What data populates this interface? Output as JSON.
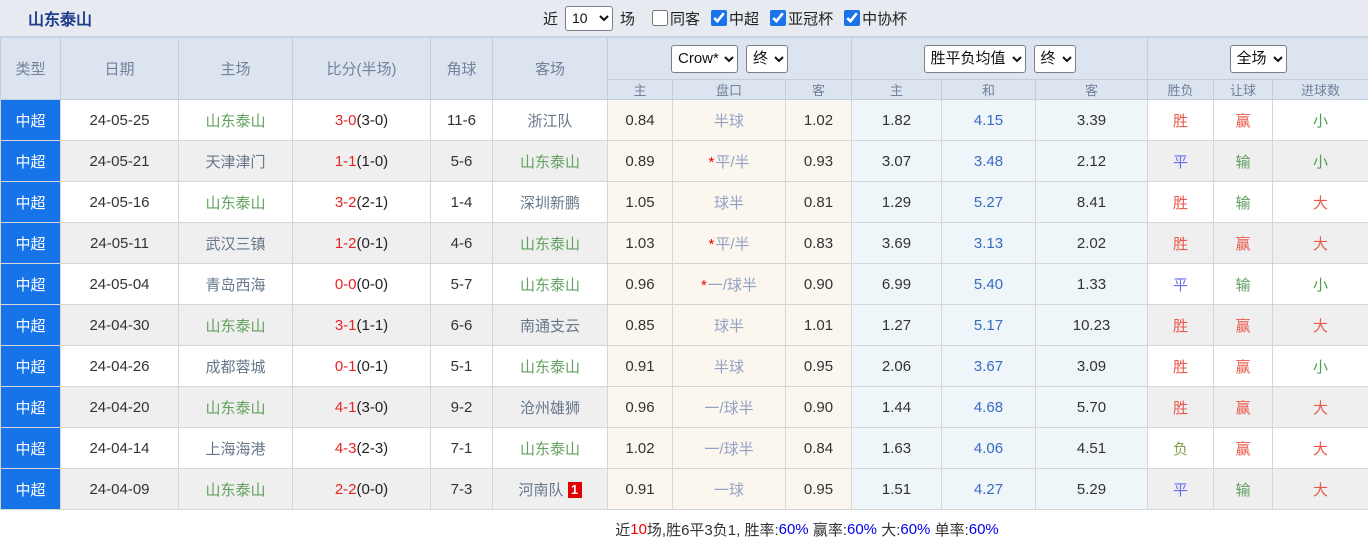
{
  "title": "山东泰山",
  "topbar": {
    "near_label": "近",
    "matches_count": "10",
    "matches_label": "场",
    "filters": [
      {
        "label": "同客",
        "checked": false
      },
      {
        "label": "中超",
        "checked": true
      },
      {
        "label": "亚冠杯",
        "checked": true
      },
      {
        "label": "中协杯",
        "checked": true
      }
    ]
  },
  "table": {
    "main_headers": [
      "类型",
      "日期",
      "主场",
      "比分(半场)",
      "角球",
      "客场"
    ],
    "asian_group": {
      "select_company": "Crow*",
      "select_time": "终",
      "sub_headers": [
        "主",
        "盘口",
        "客"
      ]
    },
    "euro_group": {
      "select_company": "胜平负均值",
      "select_time": "终",
      "sub_headers": [
        "主",
        "和",
        "客"
      ]
    },
    "result_group": {
      "select_scope": "全场",
      "sub_headers": [
        "胜负",
        "让球",
        "进球数"
      ]
    },
    "star_symbol": "*",
    "rows": [
      {
        "type": "中超",
        "date": "24-05-25",
        "home": "山东泰山",
        "score": "3-0",
        "half": "(3-0)",
        "corners": "11-6",
        "away": "浙江队",
        "away_badge": "",
        "ah_home": "0.84",
        "ah_star": false,
        "ah_line": "半球",
        "ah_away": "1.02",
        "eu_home": "1.82",
        "eu_draw": "4.15",
        "eu_away": "3.39",
        "win": "胜",
        "handicap": "赢",
        "goals": "小"
      },
      {
        "type": "中超",
        "date": "24-05-21",
        "home": "天津津门",
        "score": "1-1",
        "half": "(1-0)",
        "corners": "5-6",
        "away": "山东泰山",
        "away_badge": "",
        "ah_home": "0.89",
        "ah_star": true,
        "ah_line": "平/半",
        "ah_away": "0.93",
        "eu_home": "3.07",
        "eu_draw": "3.48",
        "eu_away": "2.12",
        "win": "平",
        "handicap": "输",
        "goals": "小"
      },
      {
        "type": "中超",
        "date": "24-05-16",
        "home": "山东泰山",
        "score": "3-2",
        "half": "(2-1)",
        "corners": "1-4",
        "away": "深圳新鹏",
        "away_badge": "",
        "ah_home": "1.05",
        "ah_star": false,
        "ah_line": "球半",
        "ah_away": "0.81",
        "eu_home": "1.29",
        "eu_draw": "5.27",
        "eu_away": "8.41",
        "win": "胜",
        "handicap": "输",
        "goals": "大"
      },
      {
        "type": "中超",
        "date": "24-05-11",
        "home": "武汉三镇",
        "score": "1-2",
        "half": "(0-1)",
        "corners": "4-6",
        "away": "山东泰山",
        "away_badge": "",
        "ah_home": "1.03",
        "ah_star": true,
        "ah_line": "平/半",
        "ah_away": "0.83",
        "eu_home": "3.69",
        "eu_draw": "3.13",
        "eu_away": "2.02",
        "win": "胜",
        "handicap": "赢",
        "goals": "大"
      },
      {
        "type": "中超",
        "date": "24-05-04",
        "home": "青岛西海",
        "score": "0-0",
        "half": "(0-0)",
        "corners": "5-7",
        "away": "山东泰山",
        "away_badge": "",
        "ah_home": "0.96",
        "ah_star": true,
        "ah_line": "一/球半",
        "ah_away": "0.90",
        "eu_home": "6.99",
        "eu_draw": "5.40",
        "eu_away": "1.33",
        "win": "平",
        "handicap": "输",
        "goals": "小"
      },
      {
        "type": "中超",
        "date": "24-04-30",
        "home": "山东泰山",
        "score": "3-1",
        "half": "(1-1)",
        "corners": "6-6",
        "away": "南通支云",
        "away_badge": "",
        "ah_home": "0.85",
        "ah_star": false,
        "ah_line": "球半",
        "ah_away": "1.01",
        "eu_home": "1.27",
        "eu_draw": "5.17",
        "eu_away": "10.23",
        "win": "胜",
        "handicap": "赢",
        "goals": "大"
      },
      {
        "type": "中超",
        "date": "24-04-26",
        "home": "成都蓉城",
        "score": "0-1",
        "half": "(0-1)",
        "corners": "5-1",
        "away": "山东泰山",
        "away_badge": "",
        "ah_home": "0.91",
        "ah_star": false,
        "ah_line": "半球",
        "ah_away": "0.95",
        "eu_home": "2.06",
        "eu_draw": "3.67",
        "eu_away": "3.09",
        "win": "胜",
        "handicap": "赢",
        "goals": "小"
      },
      {
        "type": "中超",
        "date": "24-04-20",
        "home": "山东泰山",
        "score": "4-1",
        "half": "(3-0)",
        "corners": "9-2",
        "away": "沧州雄狮",
        "away_badge": "",
        "ah_home": "0.96",
        "ah_star": false,
        "ah_line": "一/球半",
        "ah_away": "0.90",
        "eu_home": "1.44",
        "eu_draw": "4.68",
        "eu_away": "5.70",
        "win": "胜",
        "handicap": "赢",
        "goals": "大"
      },
      {
        "type": "中超",
        "date": "24-04-14",
        "home": "上海海港",
        "score": "4-3",
        "half": "(2-3)",
        "corners": "7-1",
        "away": "山东泰山",
        "away_badge": "",
        "ah_home": "1.02",
        "ah_star": false,
        "ah_line": "一/球半",
        "ah_away": "0.84",
        "eu_home": "1.63",
        "eu_draw": "4.06",
        "eu_away": "4.51",
        "win": "负",
        "handicap": "赢",
        "goals": "大"
      },
      {
        "type": "中超",
        "date": "24-04-09",
        "home": "山东泰山",
        "score": "2-2",
        "half": "(0-0)",
        "corners": "7-3",
        "away": "河南队",
        "away_badge": "1",
        "ah_home": "0.91",
        "ah_star": false,
        "ah_line": "一球",
        "ah_away": "0.95",
        "eu_home": "1.51",
        "eu_draw": "4.27",
        "eu_away": "5.29",
        "win": "平",
        "handicap": "输",
        "goals": "大"
      }
    ]
  },
  "value_colors": {
    "胜": "#e9584a",
    "平": "#6b6bf0",
    "负": "#84a050",
    "赢": "#e9584a",
    "输": "#5f9e5f",
    "大": "#e9584a",
    "小": "#4f9e4f"
  },
  "colors": {
    "self_team": "#61a05e",
    "other_team": "#66778a",
    "type_cell_blue": "#1774e8",
    "score_red": "#e92323",
    "draw_odds_blue": "#3a6bc0",
    "handicap_line_blue": "#93a1c4",
    "footer_percent_blue": "#0000ee",
    "footer_count_red": "#ee0000"
  },
  "footer": {
    "segments": [
      {
        "text": "近",
        "color": "#333333"
      },
      {
        "text": "10",
        "color": "#ee0000"
      },
      {
        "text": "场,胜6平3负1, 胜率:",
        "color": "#333333"
      },
      {
        "text": "60%",
        "color": "#0000ee"
      },
      {
        "text": " 赢率:",
        "color": "#333333"
      },
      {
        "text": "60%",
        "color": "#0000ee"
      },
      {
        "text": " 大:",
        "color": "#333333"
      },
      {
        "text": "60%",
        "color": "#0000ee"
      },
      {
        "text": " 单率:",
        "color": "#333333"
      },
      {
        "text": "60%",
        "color": "#0000ee"
      }
    ]
  }
}
